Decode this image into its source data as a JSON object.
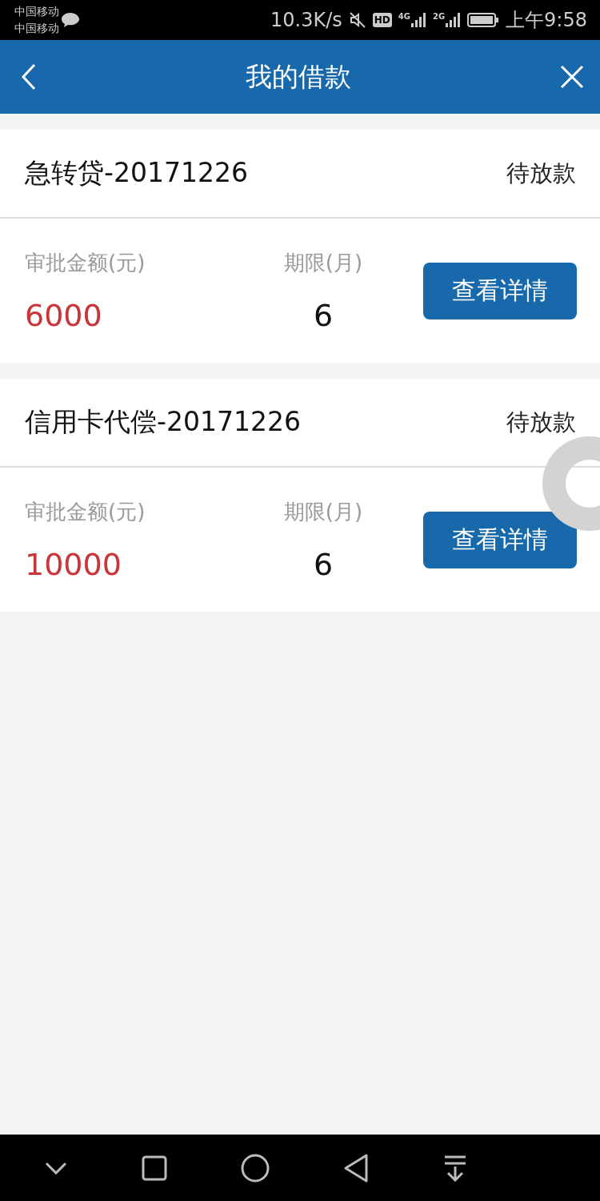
{
  "status_bar": {
    "carriers": [
      "中国移动",
      "中国移动"
    ],
    "speed": "10.3K/s",
    "hd": "HD",
    "networks": [
      "4G",
      "2G"
    ],
    "time": "上午9:58"
  },
  "header": {
    "title": "我的借款"
  },
  "loans": [
    {
      "title": "急转贷-20171226",
      "status": "待放款",
      "amount_label": "审批金额(元)",
      "amount": "6000",
      "term_label": "期限(月)",
      "term": "6",
      "button": "查看详情"
    },
    {
      "title": "信用卡代偿-20171226",
      "status": "待放款",
      "amount_label": "审批金额(元)",
      "amount": "10000",
      "term_label": "期限(月)",
      "term": "6",
      "button": "查看详情"
    }
  ]
}
